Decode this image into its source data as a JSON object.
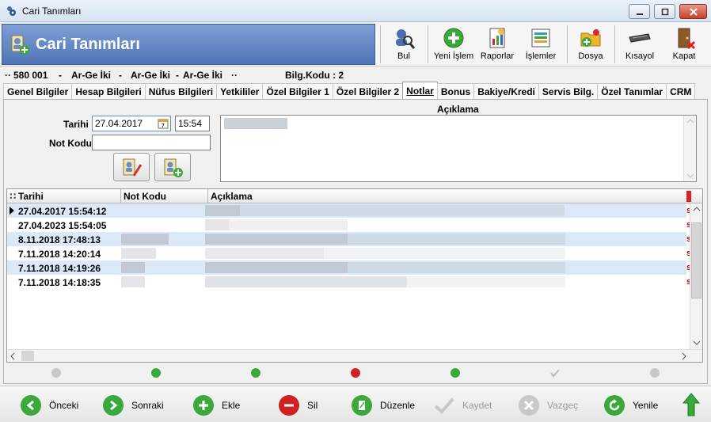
{
  "window": {
    "title": "Cari Tanımları"
  },
  "header": {
    "title": "Cari Tanımları",
    "toolbar": [
      {
        "key": "bul",
        "label": "Bul",
        "icon": "search-user-icon"
      },
      {
        "key": "yeni",
        "label": "Yeni İşlem",
        "icon": "plus-icon"
      },
      {
        "key": "raporlar",
        "label": "Raporlar",
        "icon": "report-icon"
      },
      {
        "key": "islemler",
        "label": "İşlemler",
        "icon": "operations-icon"
      },
      {
        "key": "dosya",
        "label": "Dosya",
        "icon": "folder-icon"
      },
      {
        "key": "kisayol",
        "label": "Kısayol",
        "icon": "keyboard-icon"
      },
      {
        "key": "kapat",
        "label": "Kapat",
        "icon": "exit-door-icon"
      }
    ]
  },
  "info": {
    "code": "580 001",
    "name1": "Ar-Ge İki",
    "name2": "Ar-Ge İki",
    "name3": "Ar-Ge İki",
    "bilg": "Bilg.Kodu : 2"
  },
  "tabs": [
    "Genel Bilgiler",
    "Hesap Bilgileri",
    "Nüfus Bilgileri",
    "Yetkililer",
    "Özel Bilgiler 1",
    "Özel Bilgiler 2",
    "Notlar",
    "Bonus",
    "Bakiye/Kredi",
    "Servis Bilg.",
    "Özel Tanımlar",
    "CRM"
  ],
  "active_tab": "Notlar",
  "form": {
    "tarihi_label": "Tarihi",
    "date_value": "27.04.2017",
    "time_value": "15:54",
    "notkodu_label": "Not Kodu",
    "notkodu_value": "",
    "aciklama_label": "Açıklama"
  },
  "grid": {
    "headers": [
      "Tarihi",
      "Not Kodu",
      "Açıklama"
    ],
    "rows": [
      {
        "date": "27.04.2017 15:54:12"
      },
      {
        "date": "27.04.2023 15:54:05"
      },
      {
        "date": "8.11.2018 17:48:13"
      },
      {
        "date": "7.11.2018 14:20:14"
      },
      {
        "date": "7.11.2018 14:19:26"
      },
      {
        "date": "7.11.2018 14:18:35"
      }
    ]
  },
  "bottom": {
    "onceki": "Önceki",
    "sonraki": "Sonraki",
    "ekle": "Ekle",
    "sil": "Sil",
    "duzenle": "Düzenle",
    "kaydet": "Kaydet",
    "vazgec": "Vazgeç",
    "yenile": "Yenile"
  },
  "colors": {
    "accent": "#4f74b8",
    "row_alt": "#dbe8f8",
    "green": "#3aa83a",
    "red": "#d02020"
  }
}
